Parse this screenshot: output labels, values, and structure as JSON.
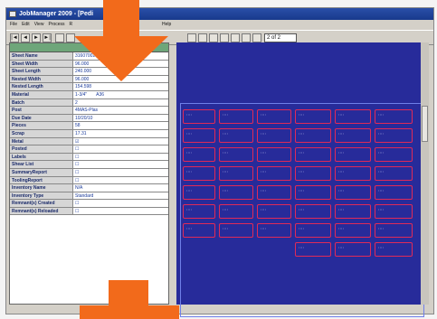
{
  "window": {
    "title": "JobManager 2009 - [Pedi"
  },
  "menu": {
    "items": [
      "File",
      "Edit",
      "View",
      "Process",
      "R"
    ],
    "right_item": "Help"
  },
  "toolbar": {
    "nav_first": "|◄",
    "nav_prev": "◄",
    "nav_next": "►",
    "nav_last": "►|",
    "page_label": "2 of 2"
  },
  "properties": {
    "header": "General",
    "rows": [
      {
        "key": "Sheet Name",
        "value": "31607002"
      },
      {
        "key": "Sheet Width",
        "value": "96.000"
      },
      {
        "key": "Sheet Length",
        "value": "240.000"
      },
      {
        "key": "Nested Width",
        "value": "96.000"
      },
      {
        "key": "Nested Length",
        "value": "154.598"
      },
      {
        "key": "Material",
        "value": "1-3/4\"",
        "unit": "A36"
      },
      {
        "key": "Batch",
        "value": "2"
      },
      {
        "key": "Post",
        "value": "4MAS-Plas"
      },
      {
        "key": "Due Date",
        "value": "10/20/10"
      },
      {
        "key": "Pieces",
        "value": "58"
      },
      {
        "key": "Scrap",
        "value": "17.31"
      },
      {
        "key": "Metal",
        "value": "☑"
      },
      {
        "key": "Posted",
        "value": "☐"
      },
      {
        "key": "Labels",
        "value": "☐"
      },
      {
        "key": "Shear List",
        "value": "☐"
      },
      {
        "key": "SummaryReport",
        "value": "☐"
      },
      {
        "key": "ToolingReport",
        "value": "☐"
      },
      {
        "key": "Inventory Name",
        "value": "N/A"
      },
      {
        "key": "Inventory Type",
        "value": "Standard"
      },
      {
        "key": "Remnant(s) Created",
        "value": "☐"
      },
      {
        "key": "Remnant(s) Reloaded",
        "value": "☐"
      }
    ]
  },
  "nest_view": {
    "part_label": "::::"
  },
  "colors": {
    "nest_background": "#272b9a",
    "part_outline": "#e02a58",
    "arrow": "#f26a1b",
    "grid_header": "#6ea67a"
  }
}
